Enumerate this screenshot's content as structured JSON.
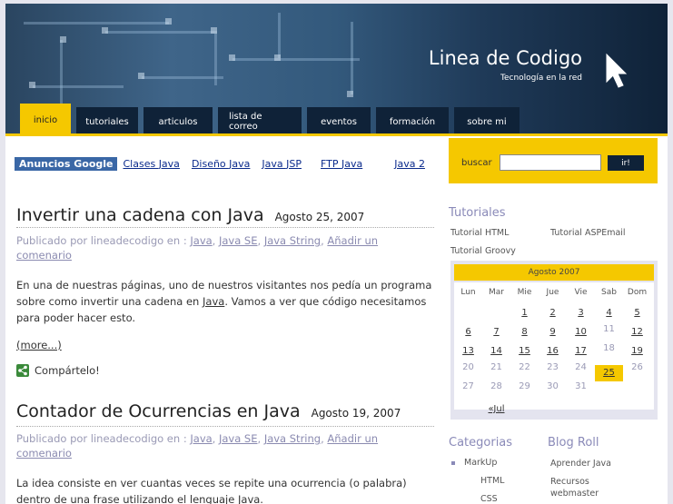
{
  "site": {
    "title": "Linea de Codigo",
    "subtitle": "Tecnología en la red"
  },
  "nav": {
    "tabs": [
      "inicio",
      "tutoriales",
      "articulos",
      "lista de correo",
      "eventos",
      "formación",
      "sobre mi"
    ],
    "active": "inicio"
  },
  "ads": {
    "label": "Anuncios Google",
    "links": [
      "Clases Java",
      "Diseño Java",
      "Java JSP",
      "FTP Java",
      "Java 2"
    ]
  },
  "search": {
    "label": "buscar",
    "value": "",
    "button": "ir!"
  },
  "posts": [
    {
      "title": "Invertir una cadena con Java",
      "date": "Agosto 25, 2007",
      "meta_prefix": "Publicado por lineadecodigo en :",
      "tags": [
        "Java",
        "Java SE",
        "Java String"
      ],
      "comment": "Añadir un comenario",
      "body_1": "En una de nuestras páginas, uno de nuestros visitantes nos pedía un programa sobre como invertir una cadena en ",
      "body_link": "Java",
      "body_2": ". Vamos a ver que código necesitamos para poder hacer esto.",
      "more": "(more...)",
      "share": "Compártelo!"
    },
    {
      "title": "Contador de Ocurrencias en Java",
      "date": "Agosto 19, 2007",
      "meta_prefix": "Publicado por lineadecodigo en :",
      "tags": [
        "Java",
        "Java SE",
        "Java String"
      ],
      "comment": "Añadir un comenario",
      "body_1": "La idea consiste en ver cuantas veces se repite una ocurrencia (o palabra) dentro de una frase utilizando el lenguaje ",
      "body_link": "Java",
      "body_2": "."
    }
  ],
  "sidebar": {
    "tutorials_heading": "Tutoriales",
    "tutorials": [
      "Tutorial HTML",
      "Tutorial ASPEmail",
      "Tutorial Groovy"
    ],
    "calendar": {
      "month": "Agosto 2007",
      "days": [
        "Lun",
        "Mar",
        "Mie",
        "Jue",
        "Vie",
        "Sab",
        "Dom"
      ],
      "rows": [
        [
          "",
          "",
          "1",
          "2",
          "3",
          "4",
          "5"
        ],
        [
          "6",
          "7",
          "8",
          "9",
          "10",
          "11",
          "12"
        ],
        [
          "13",
          "14",
          "15",
          "16",
          "17",
          "18",
          "19"
        ],
        [
          "20",
          "21",
          "22",
          "23",
          "24",
          "25",
          "26"
        ],
        [
          "27",
          "28",
          "29",
          "30",
          "31",
          "",
          ""
        ]
      ],
      "linked": [
        "1",
        "2",
        "3",
        "4",
        "5",
        "6",
        "7",
        "8",
        "9",
        "10",
        "12",
        "13",
        "14",
        "15",
        "16",
        "17",
        "19",
        "25"
      ],
      "today": "25",
      "prev": "«Jul"
    },
    "categories_heading": "Categorias",
    "categories": [
      {
        "label": "MarkUp",
        "level": 0
      },
      {
        "label": "HTML",
        "level": 1
      },
      {
        "label": "CSS",
        "level": 1
      }
    ],
    "blogroll_heading": "Blog Roll",
    "blogroll": [
      "Aprender Java",
      "Recursos webmaster"
    ]
  }
}
